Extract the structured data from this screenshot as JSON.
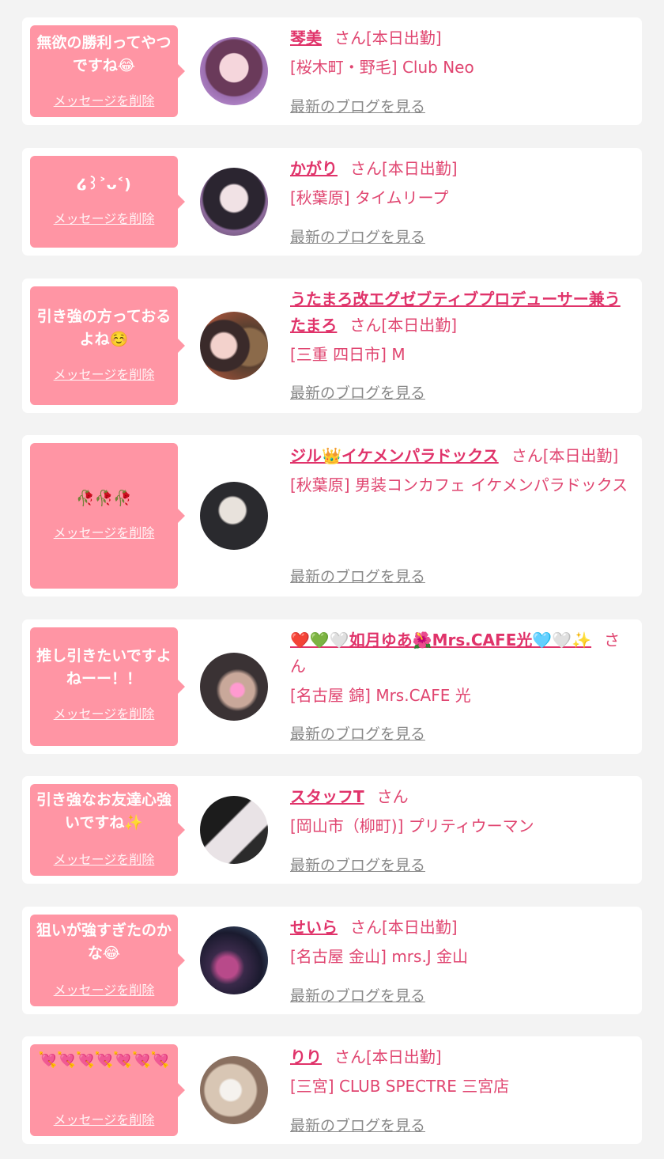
{
  "common": {
    "delete_label": "メッセージを削除",
    "blog_label": "最新のブログを見る"
  },
  "cards": [
    {
      "message": "無欲の勝利ってやつですね😂",
      "name": "琴美",
      "suffix": "さん[本日出勤]",
      "shop": "[桜木町・野毛] Club Neo"
    },
    {
      "message": "໒꒱˃ᴗ˂)",
      "name": "かがり",
      "suffix": "さん[本日出勤]",
      "shop": "[秋葉原] タイムリープ"
    },
    {
      "message": "引き強の方っておるよね☺️",
      "name": "うたまろ改エグゼブティブプロデューサー兼うたまろ",
      "suffix": "さん[本日出勤]",
      "shop": "[三重 四日市] M"
    },
    {
      "message": "🥀🥀🥀",
      "name": "ジル👑イケメンパラドックス",
      "suffix": "さん[本日出勤]",
      "shop": "[秋葉原] 男装コンカフェ イケメンパラドックス"
    },
    {
      "message": "推し引きたいですよねーー！！",
      "name": "❤️💚🤍如月ゆあ🌺Mrs.CAFE光🩵🤍✨",
      "suffix": "さん",
      "shop": "[名古屋 錦] Mrs.CAFE 光"
    },
    {
      "message": "引き強なお友達心強いですね✨",
      "name": "スタッフT",
      "suffix": "さん",
      "shop": "[岡山市（柳町)] プリティウーマン"
    },
    {
      "message": "狙いが強すぎたのかな😂",
      "name": "せいら",
      "suffix": "さん[本日出勤]",
      "shop": "[名古屋 金山] mrs.J 金山"
    },
    {
      "message": "💘💘💘💘💘💘💘",
      "name": "りり",
      "suffix": "さん[本日出勤]",
      "shop": "[三宮] CLUB SPECTRE 三宮店"
    }
  ]
}
